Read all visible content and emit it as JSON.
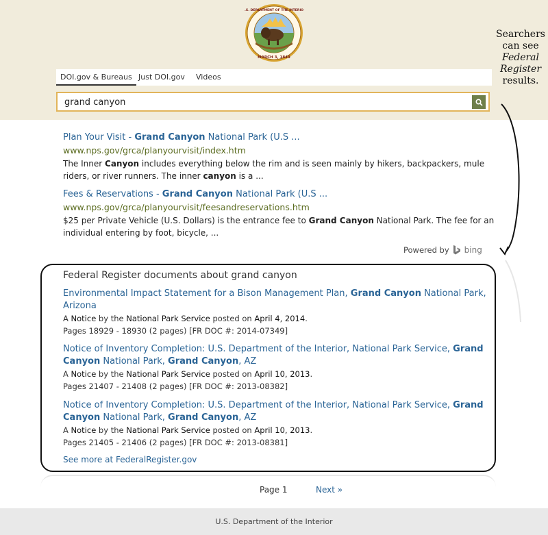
{
  "seal": {
    "name": "U.S. Department of the Interior seal",
    "top_text": "U.S. DEPARTMENT OF THE INTERIOR",
    "bottom_text": "MARCH 3, 1849"
  },
  "annotation": {
    "line1": "Searchers",
    "line2": "can see",
    "line3": "Federal",
    "line4": "Register",
    "line5": "results."
  },
  "tabs": [
    {
      "label": "DOI.gov & Bureaus",
      "active": true
    },
    {
      "label": "Just DOI.gov",
      "active": false
    },
    {
      "label": "Videos",
      "active": false
    }
  ],
  "search": {
    "value": "grand canyon",
    "button_icon": "search-icon"
  },
  "results": [
    {
      "title_pre": "Plan Your Visit - ",
      "title_bold": "Grand Canyon",
      "title_post": " National Park (U.S ...",
      "url": "www.nps.gov/grca/planyourvisit/index.htm",
      "desc_1": "The Inner ",
      "desc_b1": "Canyon",
      "desc_2": " includes everything below the rim and is seen mainly by hikers, backpackers, mule riders, or river runners. The inner ",
      "desc_b2": "canyon",
      "desc_3": " is a ..."
    },
    {
      "title_pre": "Fees & Reservations - ",
      "title_bold": "Grand Canyon",
      "title_post": " National Park (U.S ...",
      "url": "www.nps.gov/grca/planyourvisit/feesandreservations.htm",
      "desc_1": "$25 per Private Vehicle (U.S. Dollars) is the entrance fee to ",
      "desc_b1": "Grand Canyon",
      "desc_2": " National Park. The fee for an individual entering by foot, bicycle, ..."
    }
  ],
  "powered_by": {
    "label": "Powered by",
    "brand": "bing"
  },
  "federal_register": {
    "heading": "Federal Register documents about grand canyon",
    "items": [
      {
        "t1": "Environmental Impact Statement for a Bison Management Plan, ",
        "tb1": "Grand Canyon",
        "t2": " National Park, Arizona",
        "m_a": "A ",
        "m_type": "Notice",
        "m_by": " by the ",
        "m_agency": "National Park Service",
        "m_posted": " posted on ",
        "m_date": "April 4, 2014",
        "m_end": ".",
        "pages": "Pages 18929 - 18930 (2 pages) [FR DOC #: 2014-07349]"
      },
      {
        "t1": "Notice of Inventory Completion: U.S. Department of the Interior, National Park Service, ",
        "tb1": "Grand Canyon",
        "t2": " National Park, ",
        "tb2": "Grand Canyon",
        "t3": ", AZ",
        "m_a": "A ",
        "m_type": "Notice",
        "m_by": " by the ",
        "m_agency": "National Park Service",
        "m_posted": " posted on ",
        "m_date": "April 10, 2013",
        "m_end": ".",
        "pages": "Pages 21407 - 21408 (2 pages) [FR DOC #: 2013-08382]"
      },
      {
        "t1": "Notice of Inventory Completion: U.S. Department of the Interior, National Park Service, ",
        "tb1": "Grand Canyon",
        "t2": " National Park, ",
        "tb2": "Grand Canyon",
        "t3": ", AZ",
        "m_a": "A ",
        "m_type": "Notice",
        "m_by": " by the ",
        "m_agency": "National Park Service",
        "m_posted": " posted on ",
        "m_date": "April 10, 2013",
        "m_end": ".",
        "pages": "Pages 21405 - 21406 (2 pages) [FR DOC #: 2013-08381]"
      }
    ],
    "see_more": "See more at FederalRegister.gov"
  },
  "pagination": {
    "current": "Page 1",
    "next": "Next »"
  },
  "footer": {
    "text": "U.S. Department of the Interior"
  },
  "colors": {
    "band": "#f1ecdc",
    "link": "#2a6496",
    "url": "#5a6b1f",
    "search_border": "#e2b45a",
    "search_button": "#6e7f4a"
  }
}
